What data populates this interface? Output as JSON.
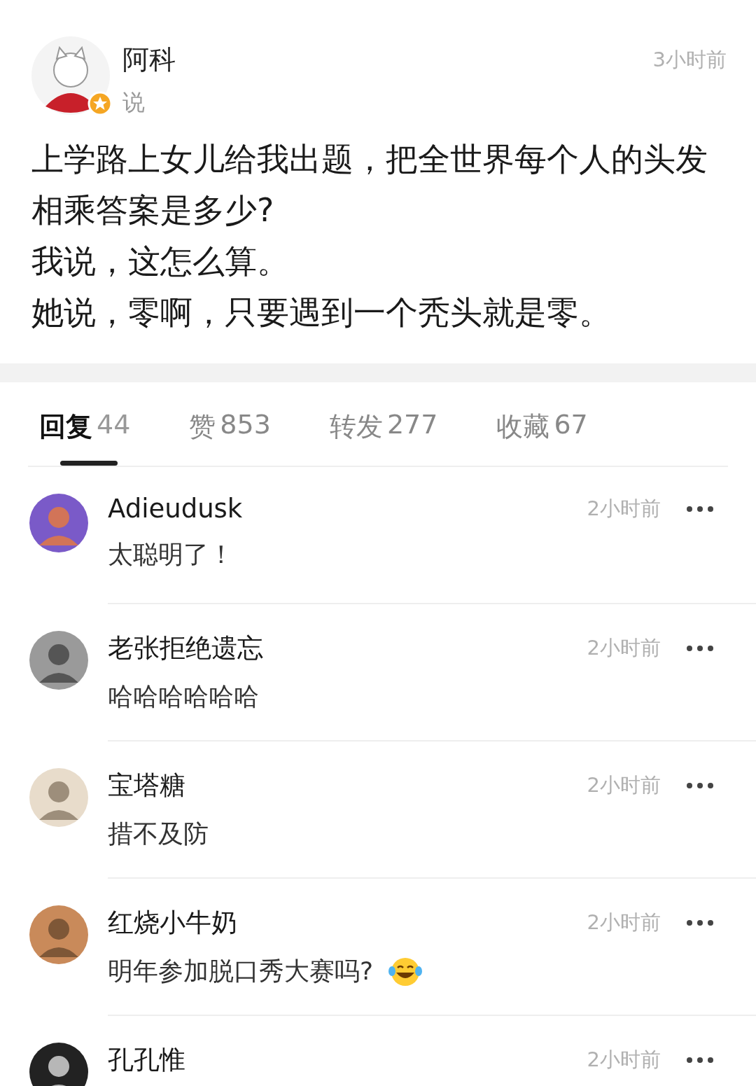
{
  "post": {
    "author": "阿科",
    "verb": "说",
    "time": "3小时前",
    "verified": true,
    "lines": [
      "上学路上女儿给我出题，把全世界每个人的头发相乘答案是多少?",
      "我说，这怎么算。",
      "她说，零啊，只要遇到一个秃头就是零。"
    ]
  },
  "tabs": [
    {
      "label": "回复",
      "count": "44",
      "selected": true
    },
    {
      "label": "赞",
      "count": "853",
      "selected": false
    },
    {
      "label": "转发",
      "count": "277",
      "selected": false
    },
    {
      "label": "收藏",
      "count": "67",
      "selected": false
    }
  ],
  "comments": [
    {
      "name": "Adieudusk",
      "time": "2小时前",
      "text": "太聪明了！",
      "emoji": false
    },
    {
      "name": "老张拒绝遗忘",
      "time": "2小时前",
      "text": "哈哈哈哈哈哈",
      "emoji": false
    },
    {
      "name": "宝塔糖",
      "time": "2小时前",
      "text": "措不及防",
      "emoji": false
    },
    {
      "name": "红烧小牛奶",
      "time": "2小时前",
      "text": "明年参加脱口秀大赛吗?",
      "emoji": true
    },
    {
      "name": "孔孔惟",
      "time": "2小时前",
      "emoji": false
    }
  ]
}
